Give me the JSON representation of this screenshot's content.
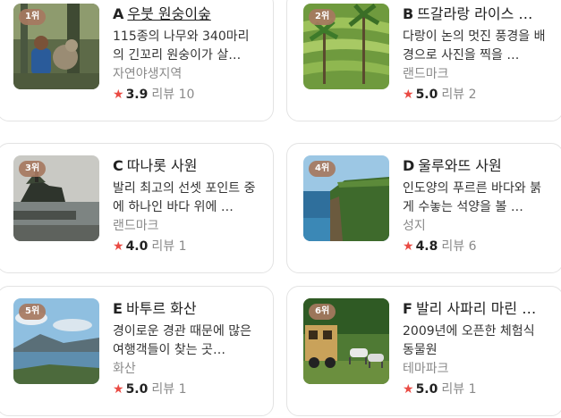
{
  "cards": [
    {
      "rank": "1위",
      "letter": "A",
      "name": "우붓 원숭이숲",
      "desc": "115종의 나무와 340마리의 긴꼬리 원숭이가 살…",
      "category": "자연야생지역",
      "score": "3.9",
      "review_label": "리뷰",
      "review_count": "10",
      "photo": "monkey-forest-photo"
    },
    {
      "rank": "2위",
      "letter": "B",
      "name": "뜨갈라랑 라이스 …",
      "desc": "다랑이 논의 멋진 풍경을 배경으로 사진을 찍을 …",
      "category": "랜드마크",
      "score": "5.0",
      "review_label": "리뷰",
      "review_count": "2",
      "photo": "rice-terrace-photo"
    },
    {
      "rank": "3위",
      "letter": "C",
      "name": "따나롯 사원",
      "desc": "발리 최고의 선셋 포인트 중에 하나인 바다 위에 …",
      "category": "랜드마크",
      "score": "4.0",
      "review_label": "리뷰",
      "review_count": "1",
      "photo": "sea-temple-photo"
    },
    {
      "rank": "4위",
      "letter": "D",
      "name": "울루와뜨 사원",
      "desc": "인도양의 푸르른 바다와 붉게 수놓는 석양을 볼 …",
      "category": "성지",
      "score": "4.8",
      "review_label": "리뷰",
      "review_count": "6",
      "photo": "cliff-temple-photo"
    },
    {
      "rank": "5위",
      "letter": "E",
      "name": "바투르 화산",
      "desc": "경이로운 경관 때문에 많은 여행객들이 찾는 곳…",
      "category": "화산",
      "score": "5.0",
      "review_label": "리뷰",
      "review_count": "1",
      "photo": "volcano-lake-photo"
    },
    {
      "rank": "6위",
      "letter": "F",
      "name": "발리 사파리 마린 …",
      "desc": "2009년에 오픈한 체험식 동물원",
      "category": "테마파크",
      "score": "5.0",
      "review_label": "리뷰",
      "review_count": "1",
      "photo": "safari-park-photo"
    }
  ],
  "star_glyph": "★",
  "colors": {
    "star": "#ea4b44",
    "badge": "#a6785f",
    "muted": "#8a8a8a",
    "border": "#e3e3e3"
  }
}
